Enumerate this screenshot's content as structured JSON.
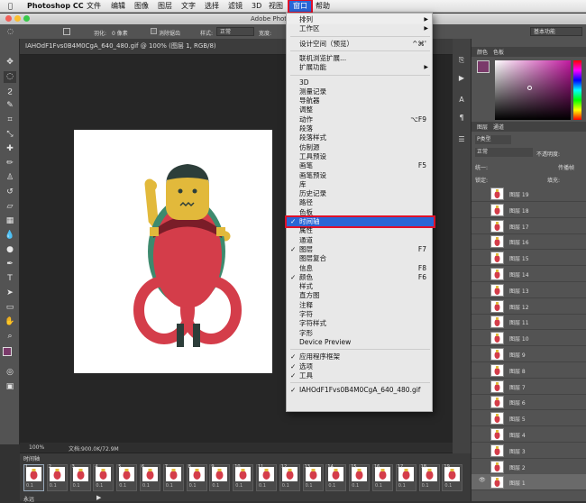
{
  "menubar": {
    "apple": "",
    "app": "Photoshop CC",
    "items": [
      "文件",
      "编辑",
      "图像",
      "图层",
      "文字",
      "选择",
      "滤镜",
      "3D",
      "视图"
    ],
    "window": "窗口",
    "help": "帮助"
  },
  "document": {
    "title": "Adobe Photo",
    "tab": "IAHOdF1Fvs0B4M0CgA_640_480.gif @ 100% (图层 1, RGB/8)",
    "zoom": "100%",
    "docinfo": "文档:900.0K/72.9M"
  },
  "options": {
    "feather_label": "羽化:",
    "feather_value": "0 像素",
    "antialias": "消除锯齿",
    "style_label": "样式:",
    "style_value": "正常",
    "width_label": "宽度:",
    "adjust": "调整边缘...",
    "workspace": "基本功能"
  },
  "window_menu": {
    "items": [
      {
        "label": "排列",
        "arrow": true
      },
      {
        "label": "工作区",
        "arrow": true
      },
      {
        "sep": true
      },
      {
        "label": "设计空间（预览）",
        "shortcut": "^⌘'"
      },
      {
        "sep": true
      },
      {
        "label": "联机浏览扩展..."
      },
      {
        "label": "扩展功能",
        "arrow": true
      },
      {
        "sep": true
      },
      {
        "label": "3D"
      },
      {
        "label": "测量记录"
      },
      {
        "label": "导航器"
      },
      {
        "label": "调整"
      },
      {
        "label": "动作",
        "shortcut": "⌥F9"
      },
      {
        "label": "段落"
      },
      {
        "label": "段落样式"
      },
      {
        "label": "仿制源"
      },
      {
        "label": "工具预设"
      },
      {
        "label": "画笔",
        "shortcut": "F5"
      },
      {
        "label": "画笔预设"
      },
      {
        "label": "库"
      },
      {
        "label": "历史记录"
      },
      {
        "label": "路径"
      },
      {
        "label": "色板"
      },
      {
        "label": "时间轴",
        "checked": true,
        "highlight": true
      },
      {
        "label": "属性"
      },
      {
        "label": "通道"
      },
      {
        "label": "图层",
        "checked": true,
        "shortcut": "F7"
      },
      {
        "label": "图层复合"
      },
      {
        "label": "信息",
        "shortcut": "F8"
      },
      {
        "label": "颜色",
        "checked": true,
        "shortcut": "F6"
      },
      {
        "label": "样式"
      },
      {
        "label": "直方图"
      },
      {
        "label": "注释"
      },
      {
        "label": "字符"
      },
      {
        "label": "字符样式"
      },
      {
        "label": "字形"
      },
      {
        "label": "Device Preview"
      },
      {
        "sep": true
      },
      {
        "label": "应用程序框架",
        "checked": true
      },
      {
        "label": "选项",
        "checked": true
      },
      {
        "label": "工具",
        "checked": true
      },
      {
        "sep": true
      },
      {
        "label": "IAHOdF1Fvs0B4M0CgA_640_480.gif",
        "checked": true
      }
    ]
  },
  "panels": {
    "color_tabs": [
      "颜色",
      "色板"
    ],
    "layer_tabs": [
      "图层",
      "通道"
    ],
    "kind": "P类型",
    "blend": "正常",
    "opacity_label": "不透明度:",
    "unify": "统一:",
    "propagate": "传播帧",
    "lock": "锁定:",
    "fill": "填充:",
    "layers": [
      "图层 19",
      "图层 18",
      "图层 17",
      "图层 16",
      "图层 15",
      "图层 14",
      "图层 13",
      "图层 12",
      "图层 11",
      "图层 10",
      "图层 9",
      "图层 8",
      "图层 7",
      "图层 6",
      "图层 5",
      "图层 4",
      "图层 3",
      "图层 2",
      "图层 1"
    ]
  },
  "timeline": {
    "title": "时间轴",
    "frames": [
      "1",
      "2",
      "3",
      "4",
      "5",
      "6",
      "7",
      "8",
      "9",
      "10",
      "11",
      "12",
      "13",
      "14",
      "15",
      "16",
      "17",
      "18",
      "19"
    ],
    "duration": "0.1",
    "loop": "永远"
  },
  "colors": {
    "highlight": "#2a66d6",
    "outline": "#e0102a",
    "foreground": "#7a3a6a"
  }
}
